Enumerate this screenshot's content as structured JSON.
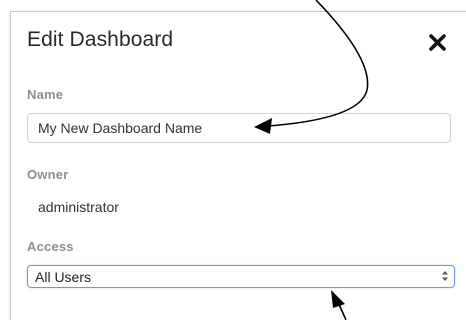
{
  "dialog": {
    "title": "Edit Dashboard",
    "close_icon": "close-x-icon"
  },
  "fields": {
    "name": {
      "label": "Name",
      "value": "My New Dashboard Name"
    },
    "owner": {
      "label": "Owner",
      "value": "administrator"
    },
    "access": {
      "label": "Access",
      "selected": "All Users",
      "icon": "select-caret-icon"
    }
  },
  "colors": {
    "label": "#8f8f8f",
    "text": "#333333",
    "focus_border": "#6a9bd8",
    "annotation_arrow": "#000000"
  }
}
